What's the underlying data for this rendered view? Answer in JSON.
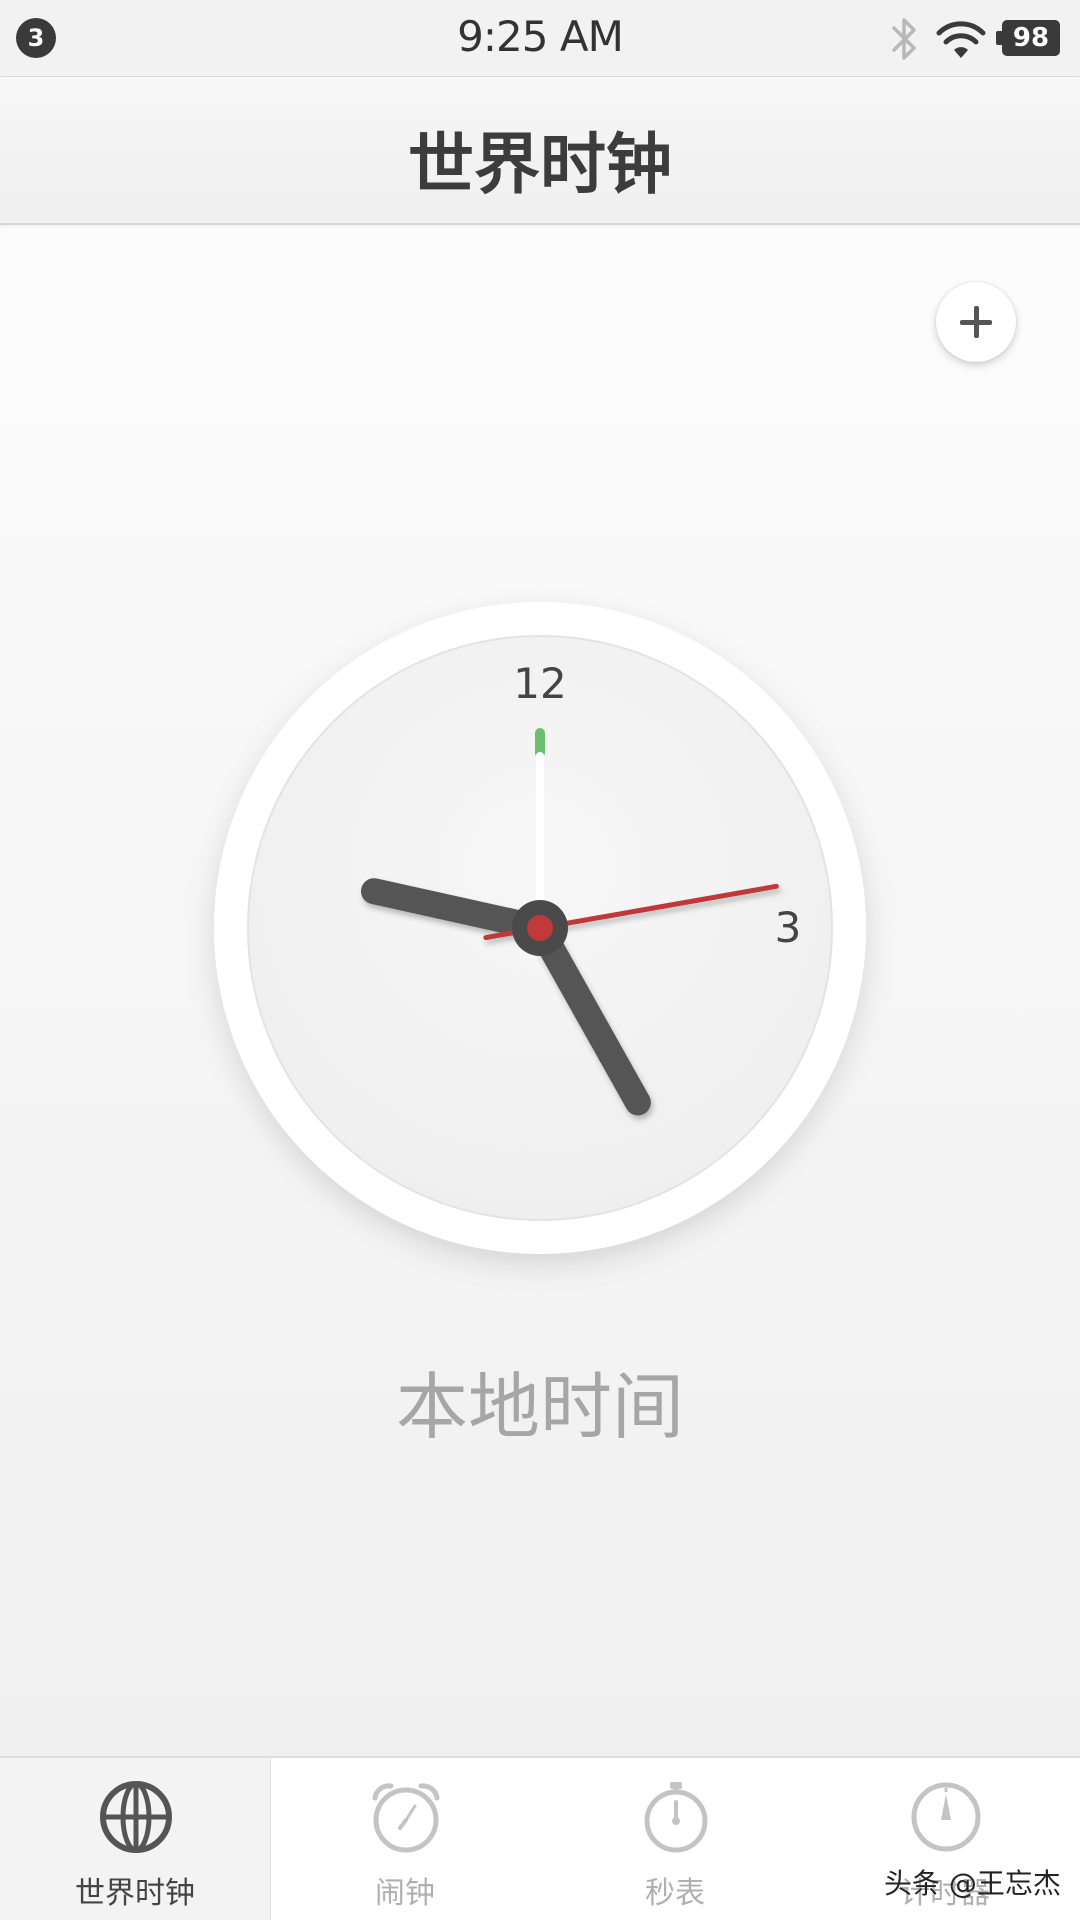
{
  "status_bar": {
    "notification_count": "3",
    "time": "9:25 AM",
    "battery": "98",
    "icons": [
      "bluetooth-icon",
      "wifi-icon",
      "battery-icon"
    ]
  },
  "header": {
    "title": "世界时钟"
  },
  "actions": {
    "add_icon": "plus-icon"
  },
  "clock": {
    "numerals": {
      "twelve": "12",
      "three": "3"
    },
    "time": {
      "hour": 9,
      "minute": 25,
      "second": 7
    },
    "caption": "本地时间",
    "colors": {
      "second_hand": "#c0393b",
      "hour_minute_hands": "#555555",
      "twelve_marker": "#6cbf6c"
    }
  },
  "tabs": [
    {
      "label": "世界时钟",
      "icon": "globe-icon",
      "active": true
    },
    {
      "label": "闹钟",
      "icon": "alarm-clock-icon",
      "active": false
    },
    {
      "label": "秒表",
      "icon": "stopwatch-icon",
      "active": false
    },
    {
      "label": "计时器",
      "icon": "timer-icon",
      "active": false
    }
  ],
  "watermark": "头条 @王忘杰"
}
